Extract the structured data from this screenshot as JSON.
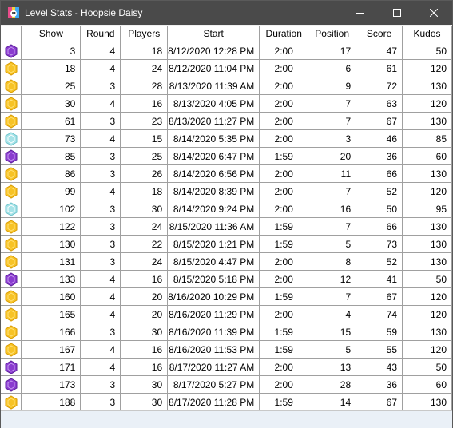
{
  "window": {
    "title": "Level Stats - Hoopsie Daisy"
  },
  "colors": {
    "gold": "#f7c326",
    "purple": "#8a3ccf",
    "cyan": "#a6e3e8"
  },
  "columns": [
    "",
    "Show",
    "Round",
    "Players",
    "Start",
    "Duration",
    "Position",
    "Score",
    "Kudos"
  ],
  "rows": [
    {
      "medal": "purple",
      "show": "3",
      "round": "4",
      "players": "18",
      "start": "8/12/2020 12:28 PM",
      "duration": "2:00",
      "position": "17",
      "score": "47",
      "kudos": "50"
    },
    {
      "medal": "gold",
      "show": "18",
      "round": "4",
      "players": "24",
      "start": "8/12/2020 11:04 PM",
      "duration": "2:00",
      "position": "6",
      "score": "61",
      "kudos": "120"
    },
    {
      "medal": "gold",
      "show": "25",
      "round": "3",
      "players": "28",
      "start": "8/13/2020 11:39 AM",
      "duration": "2:00",
      "position": "9",
      "score": "72",
      "kudos": "130"
    },
    {
      "medal": "gold",
      "show": "30",
      "round": "4",
      "players": "16",
      "start": "8/13/2020 4:05 PM",
      "duration": "2:00",
      "position": "7",
      "score": "63",
      "kudos": "120"
    },
    {
      "medal": "gold",
      "show": "61",
      "round": "3",
      "players": "23",
      "start": "8/13/2020 11:27 PM",
      "duration": "2:00",
      "position": "7",
      "score": "67",
      "kudos": "130"
    },
    {
      "medal": "cyan",
      "show": "73",
      "round": "4",
      "players": "15",
      "start": "8/14/2020 5:35 PM",
      "duration": "2:00",
      "position": "3",
      "score": "46",
      "kudos": "85"
    },
    {
      "medal": "purple",
      "show": "85",
      "round": "3",
      "players": "25",
      "start": "8/14/2020 6:47 PM",
      "duration": "1:59",
      "position": "20",
      "score": "36",
      "kudos": "60"
    },
    {
      "medal": "gold",
      "show": "86",
      "round": "3",
      "players": "26",
      "start": "8/14/2020 6:56 PM",
      "duration": "2:00",
      "position": "11",
      "score": "66",
      "kudos": "130"
    },
    {
      "medal": "gold",
      "show": "99",
      "round": "4",
      "players": "18",
      "start": "8/14/2020 8:39 PM",
      "duration": "2:00",
      "position": "7",
      "score": "52",
      "kudos": "120"
    },
    {
      "medal": "cyan",
      "show": "102",
      "round": "3",
      "players": "30",
      "start": "8/14/2020 9:24 PM",
      "duration": "2:00",
      "position": "16",
      "score": "50",
      "kudos": "95"
    },
    {
      "medal": "gold",
      "show": "122",
      "round": "3",
      "players": "24",
      "start": "8/15/2020 11:36 AM",
      "duration": "1:59",
      "position": "7",
      "score": "66",
      "kudos": "130"
    },
    {
      "medal": "gold",
      "show": "130",
      "round": "3",
      "players": "22",
      "start": "8/15/2020 1:21 PM",
      "duration": "1:59",
      "position": "5",
      "score": "73",
      "kudos": "130"
    },
    {
      "medal": "gold",
      "show": "131",
      "round": "3",
      "players": "24",
      "start": "8/15/2020 4:47 PM",
      "duration": "2:00",
      "position": "8",
      "score": "52",
      "kudos": "130"
    },
    {
      "medal": "purple",
      "show": "133",
      "round": "4",
      "players": "16",
      "start": "8/15/2020 5:18 PM",
      "duration": "2:00",
      "position": "12",
      "score": "41",
      "kudos": "50"
    },
    {
      "medal": "gold",
      "show": "160",
      "round": "4",
      "players": "20",
      "start": "8/16/2020 10:29 PM",
      "duration": "1:59",
      "position": "7",
      "score": "67",
      "kudos": "120"
    },
    {
      "medal": "gold",
      "show": "165",
      "round": "4",
      "players": "20",
      "start": "8/16/2020 11:29 PM",
      "duration": "2:00",
      "position": "4",
      "score": "74",
      "kudos": "120"
    },
    {
      "medal": "gold",
      "show": "166",
      "round": "3",
      "players": "30",
      "start": "8/16/2020 11:39 PM",
      "duration": "1:59",
      "position": "15",
      "score": "59",
      "kudos": "130"
    },
    {
      "medal": "gold",
      "show": "167",
      "round": "4",
      "players": "16",
      "start": "8/16/2020 11:53 PM",
      "duration": "1:59",
      "position": "5",
      "score": "55",
      "kudos": "120"
    },
    {
      "medal": "purple",
      "show": "171",
      "round": "4",
      "players": "16",
      "start": "8/17/2020 11:27 AM",
      "duration": "2:00",
      "position": "13",
      "score": "43",
      "kudos": "50"
    },
    {
      "medal": "purple",
      "show": "173",
      "round": "3",
      "players": "30",
      "start": "8/17/2020 5:27 PM",
      "duration": "2:00",
      "position": "28",
      "score": "36",
      "kudos": "60"
    },
    {
      "medal": "gold",
      "show": "188",
      "round": "3",
      "players": "30",
      "start": "8/17/2020 11:28 PM",
      "duration": "1:59",
      "position": "14",
      "score": "67",
      "kudos": "130"
    }
  ]
}
